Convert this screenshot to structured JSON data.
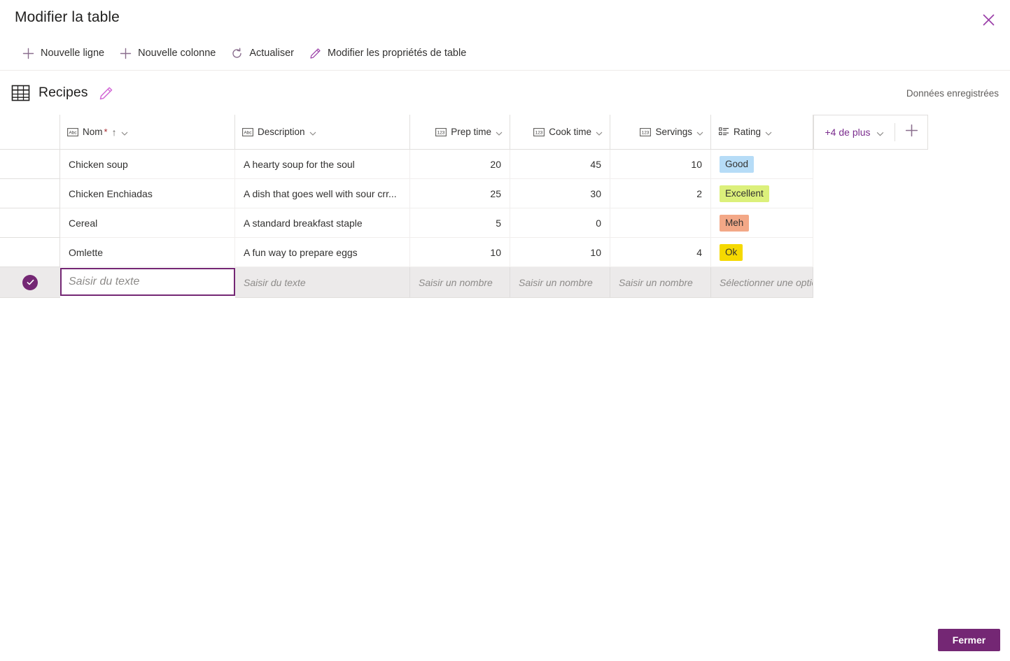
{
  "window": {
    "title": "Modifier la table",
    "close_icon": "close-icon"
  },
  "toolbar": {
    "items": [
      {
        "label": "Nouvelle ligne",
        "icon": "plus-icon"
      },
      {
        "label": "Nouvelle colonne",
        "icon": "plus-icon"
      },
      {
        "label": "Actualiser",
        "icon": "refresh-icon"
      },
      {
        "label": "Modifier les propriétés de table",
        "icon": "pencil-icon"
      }
    ]
  },
  "table_header": {
    "table_icon": "table-grid-icon",
    "table_name": "Recipes",
    "edit_icon": "pencil-icon",
    "save_status": "Données enregistrées"
  },
  "grid": {
    "columns": [
      {
        "key": "name",
        "label": "Nom",
        "type_icon": "text-type-icon",
        "required": true,
        "sorted": true,
        "sort_glyph": "↑",
        "align": "left"
      },
      {
        "key": "desc",
        "label": "Description",
        "type_icon": "text-type-icon",
        "required": false,
        "sorted": false,
        "align": "left"
      },
      {
        "key": "prep",
        "label": "Prep time",
        "type_icon": "number-type-icon",
        "required": false,
        "sorted": false,
        "align": "right"
      },
      {
        "key": "cook",
        "label": "Cook time",
        "type_icon": "number-type-icon",
        "required": false,
        "sorted": false,
        "align": "right"
      },
      {
        "key": "servings",
        "label": "Servings",
        "type_icon": "number-type-icon",
        "required": false,
        "sorted": false,
        "align": "right"
      },
      {
        "key": "rating",
        "label": "Rating",
        "type_icon": "choice-type-icon",
        "required": false,
        "sorted": false,
        "align": "left"
      }
    ],
    "more_columns_label": "+4 de plus",
    "add_column_icon": "plus-icon",
    "rows": [
      {
        "name": "Chicken soup",
        "desc": "A hearty soup for the soul",
        "prep": "20",
        "cook": "45",
        "servings": "10",
        "rating": "Good",
        "rating_color": "#b6dcf7"
      },
      {
        "name": "Chicken Enchiadas",
        "desc": "A dish that goes well with sour crr...",
        "prep": "25",
        "cook": "30",
        "servings": "2",
        "rating": "Excellent",
        "rating_color": "#dcf07b"
      },
      {
        "name": "Cereal",
        "desc": "A standard breakfast staple",
        "prep": "5",
        "cook": "0",
        "servings": "",
        "rating": "Meh",
        "rating_color": "#f3a887"
      },
      {
        "name": "Omlette",
        "desc": "A fun way to prepare eggs",
        "prep": "10",
        "cook": "10",
        "servings": "4",
        "rating": "Ok",
        "rating_color": "#f5d900"
      }
    ],
    "new_row": {
      "commit_icon": "check-circle-icon",
      "name_placeholder": "Saisir du texte",
      "desc_placeholder": "Saisir du texte",
      "prep_placeholder": "Saisir un nombre",
      "cook_placeholder": "Saisir un nombre",
      "servings_placeholder": "Saisir un nombre",
      "rating_placeholder": "Sélectionner une option"
    }
  },
  "footer": {
    "close_label": "Fermer"
  },
  "colors": {
    "accent": "#742774",
    "link": "#7b2d8e",
    "icon": "#8a6e8e",
    "grid_line": "#e1dfdd"
  }
}
